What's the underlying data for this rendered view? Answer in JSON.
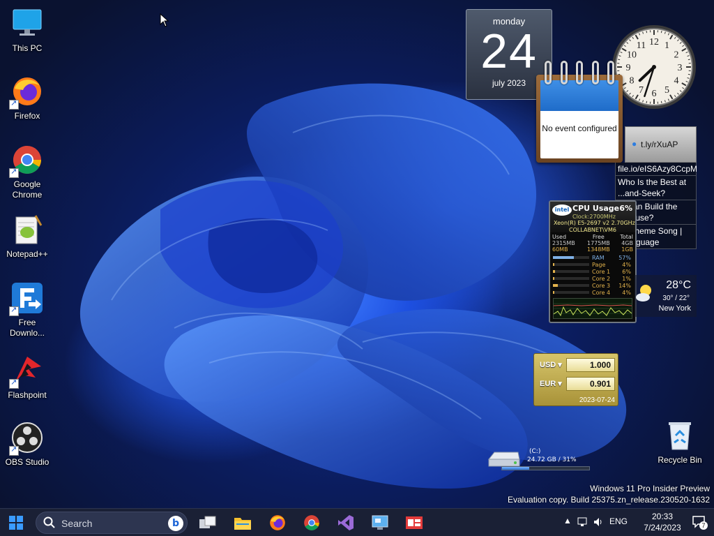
{
  "desktop_icons": [
    {
      "label": "This PC",
      "icon": "monitor-icon"
    },
    {
      "label": "Firefox",
      "icon": "firefox-icon"
    },
    {
      "label": "Google Chrome",
      "icon": "chrome-icon"
    },
    {
      "label": "Notepad++",
      "icon": "notepadpp-icon"
    },
    {
      "label": "Free Downlo...",
      "icon": "free-download-manager-icon"
    },
    {
      "label": "Flashpoint",
      "icon": "flashpoint-icon"
    },
    {
      "label": "OBS Studio",
      "icon": "obs-icon"
    }
  ],
  "recycle_bin": {
    "label": "Recycle Bin"
  },
  "calendar_gadget": {
    "weekday": "monday",
    "day": "24",
    "month_year": "july 2023"
  },
  "clock_gadget": {
    "hour": 7,
    "minute": 33
  },
  "event_gadget": {
    "text": "No event configured"
  },
  "news_gadget": {
    "header": "t.ly/rXuAP",
    "items": [
      "file.io/eIS6Azy8CcpM",
      "Who Is the Best at ...and-Seek?",
      "... Can Build the ...House?",
      "...r Theme Song | ...language"
    ]
  },
  "cpu_gadget": {
    "title": "CPU Usage",
    "usage": "6%",
    "clock": "Clock:2700MHz",
    "model": "Xeon(R) E5-2697 v2 2.70GHz",
    "host": "COLLABNET\\VM6",
    "table": {
      "headers": [
        "Used",
        "Free",
        "Total"
      ],
      "rows": [
        [
          "2315MB",
          "1775MB",
          "4GB"
        ],
        [
          "60MB",
          "1348MB",
          "1GB"
        ]
      ]
    },
    "bars": [
      {
        "name": "RAM",
        "value": "57%",
        "fraction": 0.57,
        "color": "#7fb0e6"
      },
      {
        "name": "Page",
        "value": "4%",
        "fraction": 0.04,
        "color": "#e2b24c"
      },
      {
        "name": "Core 1",
        "value": "6%",
        "fraction": 0.06,
        "color": "#e2b24c"
      },
      {
        "name": "Core 2",
        "value": "1%",
        "fraction": 0.01,
        "color": "#e2b24c"
      },
      {
        "name": "Core 3",
        "value": "14%",
        "fraction": 0.14,
        "color": "#e2b24c"
      },
      {
        "name": "Core 4",
        "value": "4%",
        "fraction": 0.04,
        "color": "#e2b24c"
      }
    ]
  },
  "weather_gadget": {
    "temp": "28°C",
    "range": "30° / 22°",
    "city": "New York"
  },
  "currency_gadget": {
    "rows": [
      {
        "code": "USD",
        "value": "1.000"
      },
      {
        "code": "EUR",
        "value": "0.901"
      }
    ],
    "date": "2023-07-24"
  },
  "drive_gadget": {
    "name": "(C:)",
    "usage": "24.72 GB / 31%",
    "fraction": 0.31
  },
  "watermark": {
    "line1": "Windows 11 Pro Insider Preview",
    "line2": "Evaluation copy. Build 25375.zn_release.230520-1632"
  },
  "taskbar": {
    "search_placeholder": "Search",
    "bing_label": "b",
    "apps": [
      "task-view",
      "file-explorer",
      "firefox",
      "chrome",
      "visual-studio",
      "control-panel",
      "media-app"
    ]
  },
  "tray": {
    "language": "ENG",
    "time": "20:33",
    "date": "7/24/2023",
    "notification_count": "7"
  },
  "colors": {
    "taskbar": "#1a2035",
    "accent": "#1a63d6"
  }
}
